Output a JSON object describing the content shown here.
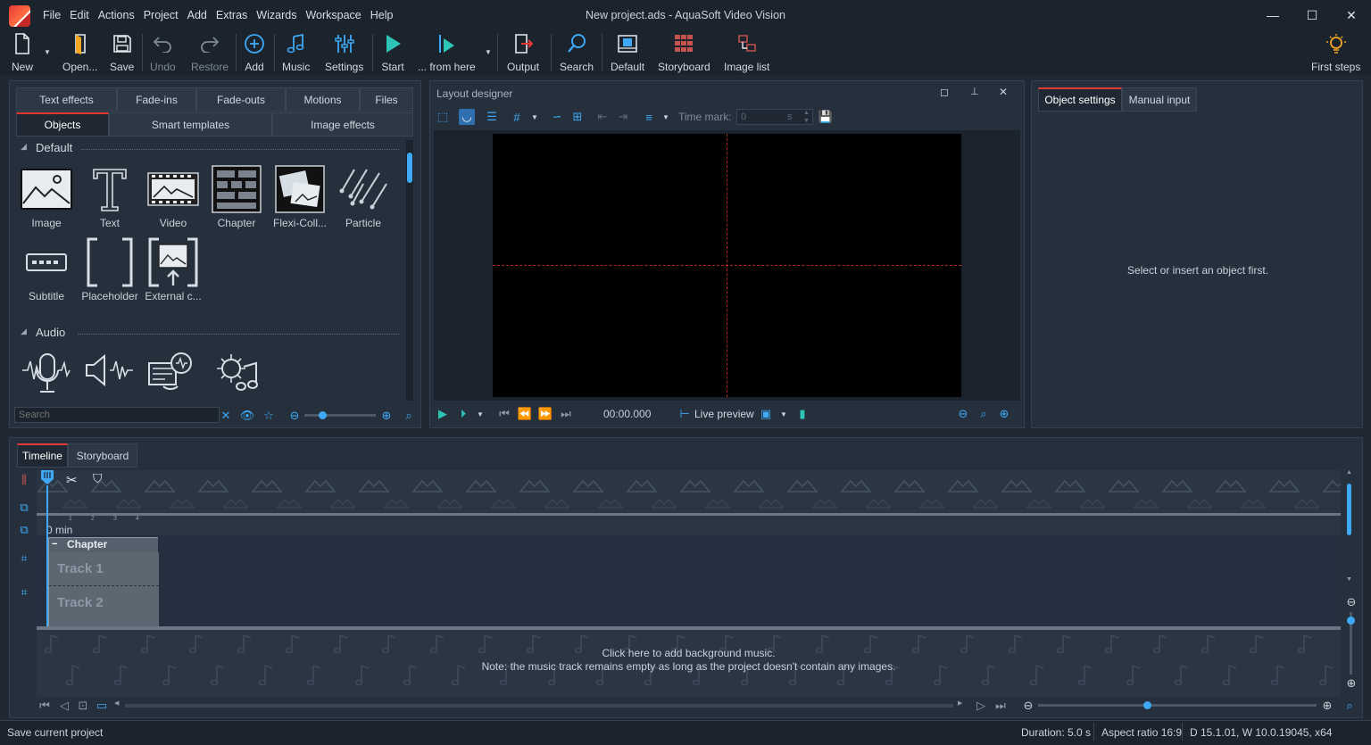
{
  "window": {
    "title": "New project.ads - AquaSoft Video Vision",
    "minimize": "—",
    "maximize": "☐",
    "close": "✕"
  },
  "menu": [
    "File",
    "Edit",
    "Actions",
    "Project",
    "Add",
    "Extras",
    "Wizards",
    "Workspace",
    "Help"
  ],
  "toolbar": {
    "new": "New",
    "open": "Open...",
    "save": "Save",
    "undo": "Undo",
    "restore": "Restore",
    "add": "Add",
    "music": "Music",
    "settings": "Settings",
    "start": "Start",
    "from_here": "... from here",
    "output": "Output",
    "search": "Search",
    "default": "Default",
    "storyboard": "Storyboard",
    "image_list": "Image list",
    "first_steps": "First steps"
  },
  "toolbox": {
    "tabs_row1": [
      "Text effects",
      "Fade-ins",
      "Fade-outs",
      "Motions",
      "Files"
    ],
    "tabs_row2": [
      "Objects",
      "Smart templates",
      "Image effects"
    ],
    "active_tab": "Objects",
    "section_default": "Default",
    "section_audio": "Audio",
    "objects": [
      "Image",
      "Text",
      "Video",
      "Chapter",
      "Flexi-Coll...",
      "Particle",
      "Subtitle",
      "Placeholder",
      "External c..."
    ],
    "search_placeholder": "Search"
  },
  "layout_designer": {
    "title": "Layout designer",
    "time_mark_label": "Time mark:",
    "time_mark_value": "0",
    "time_mark_unit": "s",
    "timecode": "00:00.000",
    "live_preview": "Live preview"
  },
  "object_settings": {
    "tabs": [
      "Object settings",
      "Manual input"
    ],
    "empty_message": "Select or insert an object first."
  },
  "timeline": {
    "tabs": [
      "Timeline",
      "Storyboard"
    ],
    "ruler_label": "0 min",
    "ruler_ticks": [
      "1",
      "2",
      "3",
      "4"
    ],
    "chapter_label": "Chapter",
    "track1": "Track 1",
    "track2": "Track 2",
    "music_hint_1": "Click here to add background music.",
    "music_hint_2": "Note: the music track remains empty as long as the project doesn't contain any images."
  },
  "status": {
    "left": "Save current project",
    "duration": "Duration: 5.0 s",
    "aspect": "Aspect ratio 16:9",
    "version": "D 15.1.01, W 10.0.19045, x64"
  },
  "colors": {
    "accent_blue": "#3fa9f5",
    "accent_red": "#e53935",
    "bg_dark": "#1b232c",
    "panel": "#25303c",
    "play_green": "#2ec4b6"
  }
}
